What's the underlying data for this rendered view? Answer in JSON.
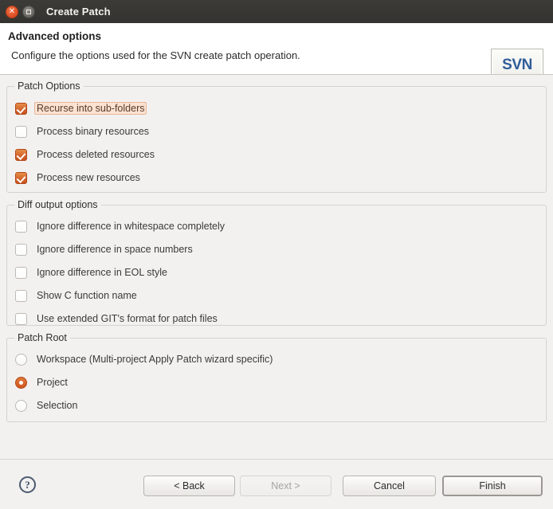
{
  "window": {
    "title": "Create Patch",
    "close_icon": "close-icon",
    "maximize_icon": "maximize-icon"
  },
  "header": {
    "title": "Advanced options",
    "description": "Configure the options used for the SVN create patch operation.",
    "banner_text": "SVN"
  },
  "groups": [
    {
      "title": "Patch Options",
      "control_type": "checkbox",
      "items": [
        {
          "label": "Recurse into sub-folders",
          "checked": true,
          "focused": true
        },
        {
          "label": "Process binary resources",
          "checked": false,
          "focused": false
        },
        {
          "label": "Process deleted resources",
          "checked": true,
          "focused": false
        },
        {
          "label": "Process new resources",
          "checked": true,
          "focused": false
        }
      ]
    },
    {
      "title": "Diff output options",
      "control_type": "checkbox",
      "items": [
        {
          "label": "Ignore difference in whitespace completely",
          "checked": false,
          "focused": false
        },
        {
          "label": "Ignore difference in space numbers",
          "checked": false,
          "focused": false
        },
        {
          "label": "Ignore difference in EOL style",
          "checked": false,
          "focused": false
        },
        {
          "label": "Show C function name",
          "checked": false,
          "focused": false
        },
        {
          "label": "Use extended GIT's format for patch files",
          "checked": false,
          "focused": false
        }
      ]
    },
    {
      "title": "Patch Root",
      "control_type": "radio",
      "items": [
        {
          "label": "Workspace (Multi-project Apply Patch wizard specific)",
          "checked": false,
          "focused": false
        },
        {
          "label": "Project",
          "checked": true,
          "focused": false
        },
        {
          "label": "Selection",
          "checked": false,
          "focused": false
        }
      ]
    }
  ],
  "buttons": {
    "help_icon": "help-icon",
    "help_glyph": "?",
    "back": {
      "label": "< Back",
      "disabled": false,
      "default": false
    },
    "next": {
      "label": "Next >",
      "disabled": true,
      "default": false
    },
    "cancel": {
      "label": "Cancel",
      "disabled": false,
      "default": false
    },
    "finish": {
      "label": "Finish",
      "disabled": false,
      "default": true
    }
  },
  "colors": {
    "titlebar": "#38372f",
    "accent": "#d4622a",
    "body_bg": "#f2f1f0",
    "header_bg": "#ffffff",
    "svn_blue": "#2f5d99"
  }
}
